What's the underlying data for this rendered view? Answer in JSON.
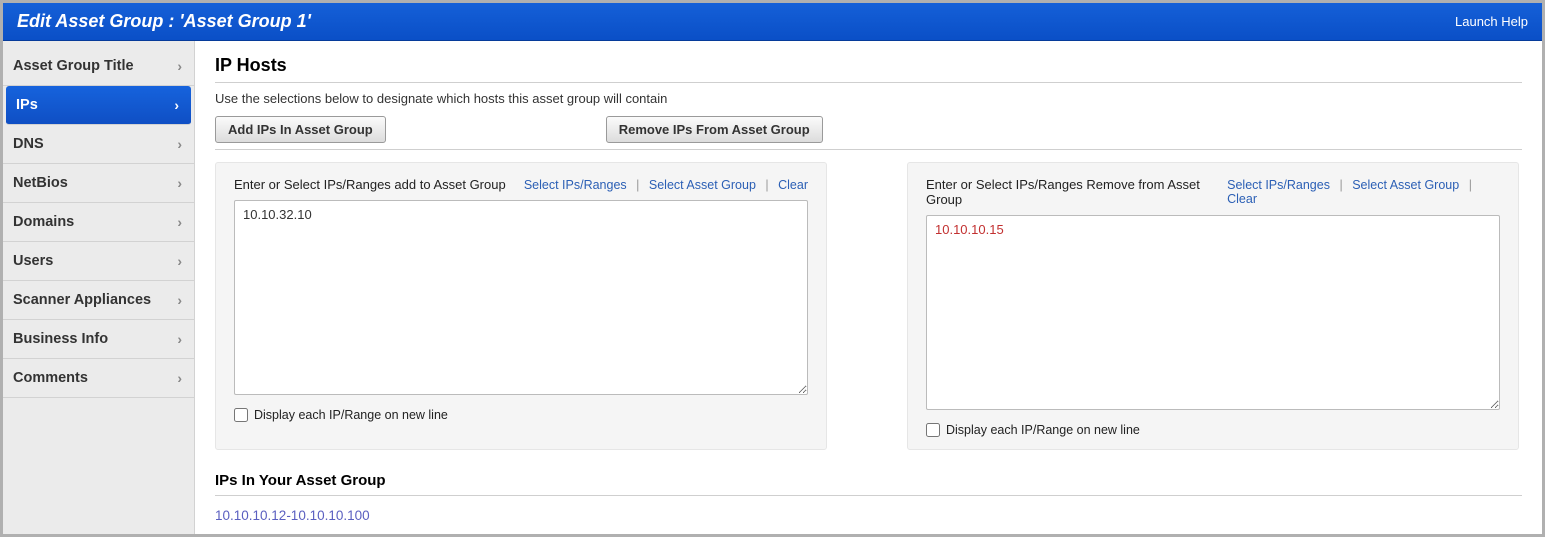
{
  "header": {
    "title": "Edit Asset Group : 'Asset Group 1'",
    "help": "Launch Help"
  },
  "sidebar": {
    "items": [
      {
        "label": "Asset Group Title",
        "active": false
      },
      {
        "label": "IPs",
        "active": true
      },
      {
        "label": "DNS",
        "active": false
      },
      {
        "label": "NetBios",
        "active": false
      },
      {
        "label": "Domains",
        "active": false
      },
      {
        "label": "Users",
        "active": false
      },
      {
        "label": "Scanner Appliances",
        "active": false
      },
      {
        "label": "Business Info",
        "active": false
      },
      {
        "label": "Comments",
        "active": false
      }
    ]
  },
  "main": {
    "heading": "IP Hosts",
    "description": "Use the selections below to designate which hosts this asset group will contain",
    "add_button": "Add IPs In Asset Group",
    "remove_button": "Remove IPs From Asset Group",
    "panel_add": {
      "label": "Enter or Select IPs/Ranges add to Asset Group",
      "link_select_ips": "Select IPs/Ranges",
      "link_select_group": "Select Asset Group",
      "link_clear": "Clear",
      "textarea_value": "10.10.32.10",
      "checkbox_label": "Display each IP/Range on new line"
    },
    "panel_remove": {
      "label": "Enter or Select IPs/Ranges Remove from Asset Group",
      "link_select_ips": "Select IPs/Ranges",
      "link_select_group": "Select Asset Group",
      "link_clear": "Clear",
      "textarea_value": "10.10.10.15",
      "checkbox_label": "Display each IP/Range on new line"
    },
    "section_ips": {
      "heading": "IPs In Your Asset Group",
      "range": "10.10.10.12-10.10.10.100"
    }
  }
}
